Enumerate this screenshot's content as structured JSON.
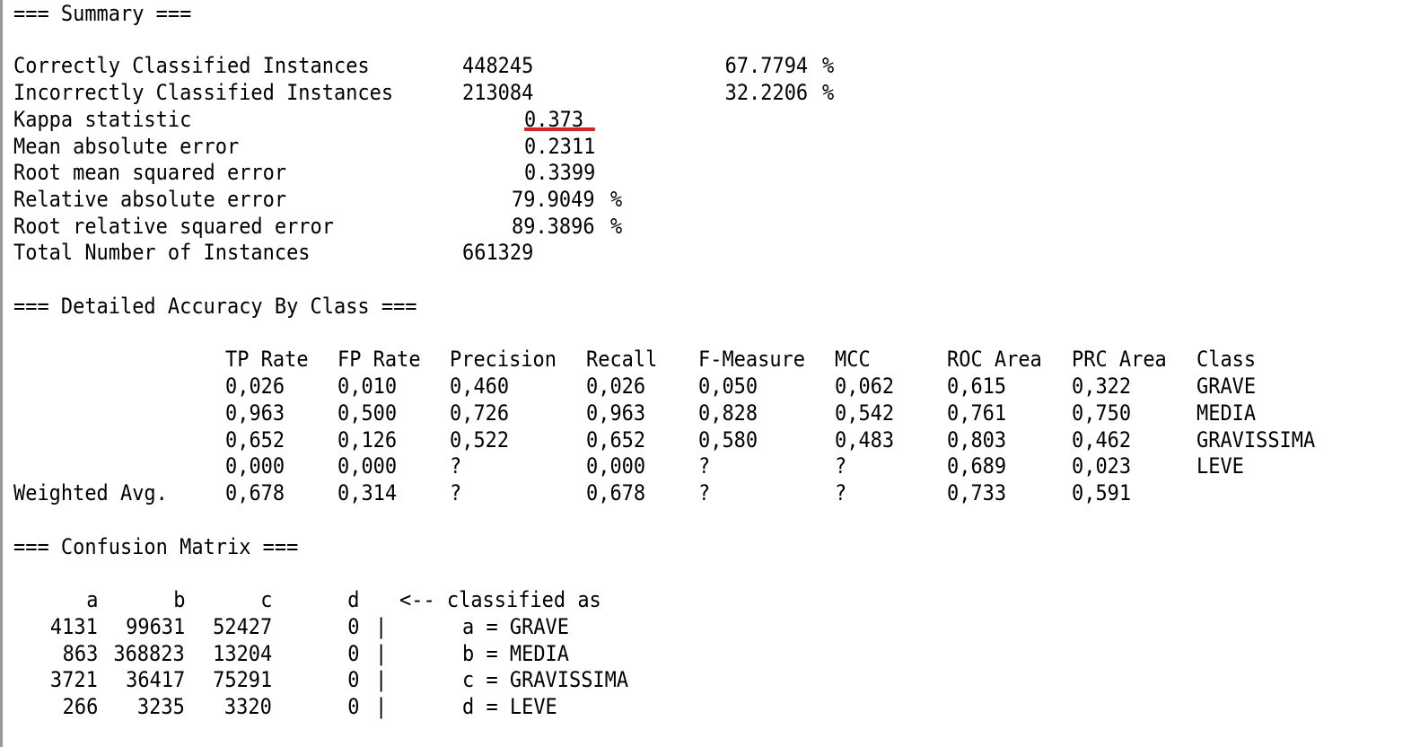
{
  "summary": {
    "header": "=== Summary ===",
    "rows": [
      {
        "label": "Correctly Classified Instances",
        "value": "448245",
        "pct": "67.7794",
        "unit": "%"
      },
      {
        "label": "Incorrectly Classified Instances",
        "value": "213084",
        "pct": "32.2206",
        "unit": "%"
      },
      {
        "label": "Kappa statistic",
        "value": "0.373"
      },
      {
        "label": "Mean absolute error",
        "value": "0.2311"
      },
      {
        "label": "Root mean squared error",
        "value": "0.3399"
      },
      {
        "label": "Relative absolute error",
        "value": "79.9049",
        "unit": "%"
      },
      {
        "label": "Root relative squared error",
        "value": "89.3896",
        "unit": "%"
      },
      {
        "label": "Total Number of Instances",
        "value": "661329"
      }
    ],
    "highlight_color": "#e02020"
  },
  "accuracy": {
    "header": "=== Detailed Accuracy By Class ===",
    "columns": [
      "TP Rate",
      "FP Rate",
      "Precision",
      "Recall",
      "F-Measure",
      "MCC",
      "ROC Area",
      "PRC Area",
      "Class"
    ],
    "rows": [
      {
        "label": "",
        "cells": [
          "0,026",
          "0,010",
          "0,460",
          "0,026",
          "0,050",
          "0,062",
          "0,615",
          "0,322",
          "GRAVE"
        ]
      },
      {
        "label": "",
        "cells": [
          "0,963",
          "0,500",
          "0,726",
          "0,963",
          "0,828",
          "0,542",
          "0,761",
          "0,750",
          "MEDIA"
        ]
      },
      {
        "label": "",
        "cells": [
          "0,652",
          "0,126",
          "0,522",
          "0,652",
          "0,580",
          "0,483",
          "0,803",
          "0,462",
          "GRAVISSIMA"
        ]
      },
      {
        "label": "",
        "cells": [
          "0,000",
          "0,000",
          "?",
          "0,000",
          "?",
          "?",
          "0,689",
          "0,023",
          "LEVE"
        ]
      },
      {
        "label": "Weighted Avg.",
        "cells": [
          "0,678",
          "0,314",
          "?",
          "0,678",
          "?",
          "?",
          "0,733",
          "0,591",
          ""
        ]
      }
    ]
  },
  "confusion": {
    "header": "=== Confusion Matrix ===",
    "col_headers": [
      "a",
      "b",
      "c",
      "d"
    ],
    "classified_as": "<-- classified as",
    "rows": [
      {
        "cells": [
          "4131",
          "99631",
          "52427",
          "0"
        ],
        "sep": "|",
        "legend": "a = GRAVE"
      },
      {
        "cells": [
          "863",
          "368823",
          "13204",
          "0"
        ],
        "sep": "|",
        "legend": "b = MEDIA"
      },
      {
        "cells": [
          "3721",
          "36417",
          "75291",
          "0"
        ],
        "sep": "|",
        "legend": "c = GRAVISSIMA"
      },
      {
        "cells": [
          "266",
          "3235",
          "3320",
          "0"
        ],
        "sep": "|",
        "legend": "d = LEVE"
      }
    ]
  }
}
